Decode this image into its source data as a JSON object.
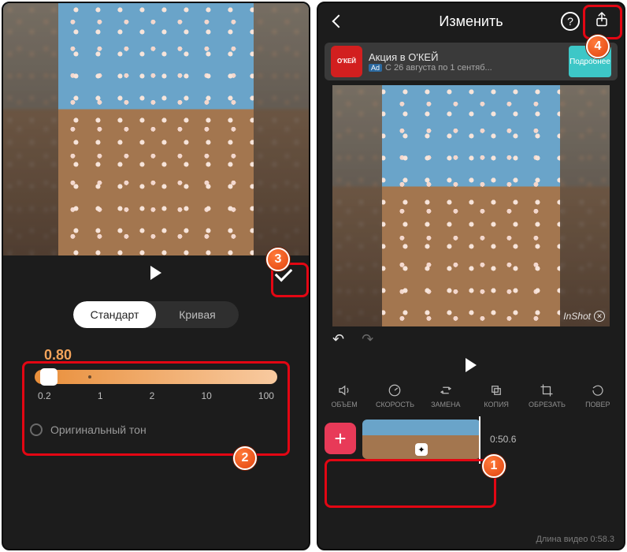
{
  "left": {
    "segments": {
      "standard": "Стандарт",
      "curve": "Кривая"
    },
    "speed": {
      "value": "0.80",
      "ticks": [
        "0.2",
        "1",
        "2",
        "10",
        "100"
      ]
    },
    "original_tone": "Оригинальный тон"
  },
  "right": {
    "header": {
      "title": "Изменить",
      "help": "?"
    },
    "ad": {
      "logo": "О'КЕЙ",
      "title": "Акция в O'КЕЙ",
      "badge": "Ad",
      "subtitle": "С 26 августа по 1 сентяб...",
      "cta": "Подробнее"
    },
    "watermark": "InShot",
    "tools": [
      {
        "label": "ОБЪЕМ"
      },
      {
        "label": "СКОРОСТЬ"
      },
      {
        "label": "ЗАМЕНА"
      },
      {
        "label": "КОПИЯ"
      },
      {
        "label": "ОБРЕЗАТЬ"
      },
      {
        "label": "ПОВЕР"
      }
    ],
    "timeline": {
      "current": "0:50.6"
    },
    "footer": "Длина видео 0:58.3",
    "add_plus": "+",
    "clip_icon": "✦"
  },
  "badges": {
    "b1": "1",
    "b2": "2",
    "b3": "3",
    "b4": "4"
  }
}
